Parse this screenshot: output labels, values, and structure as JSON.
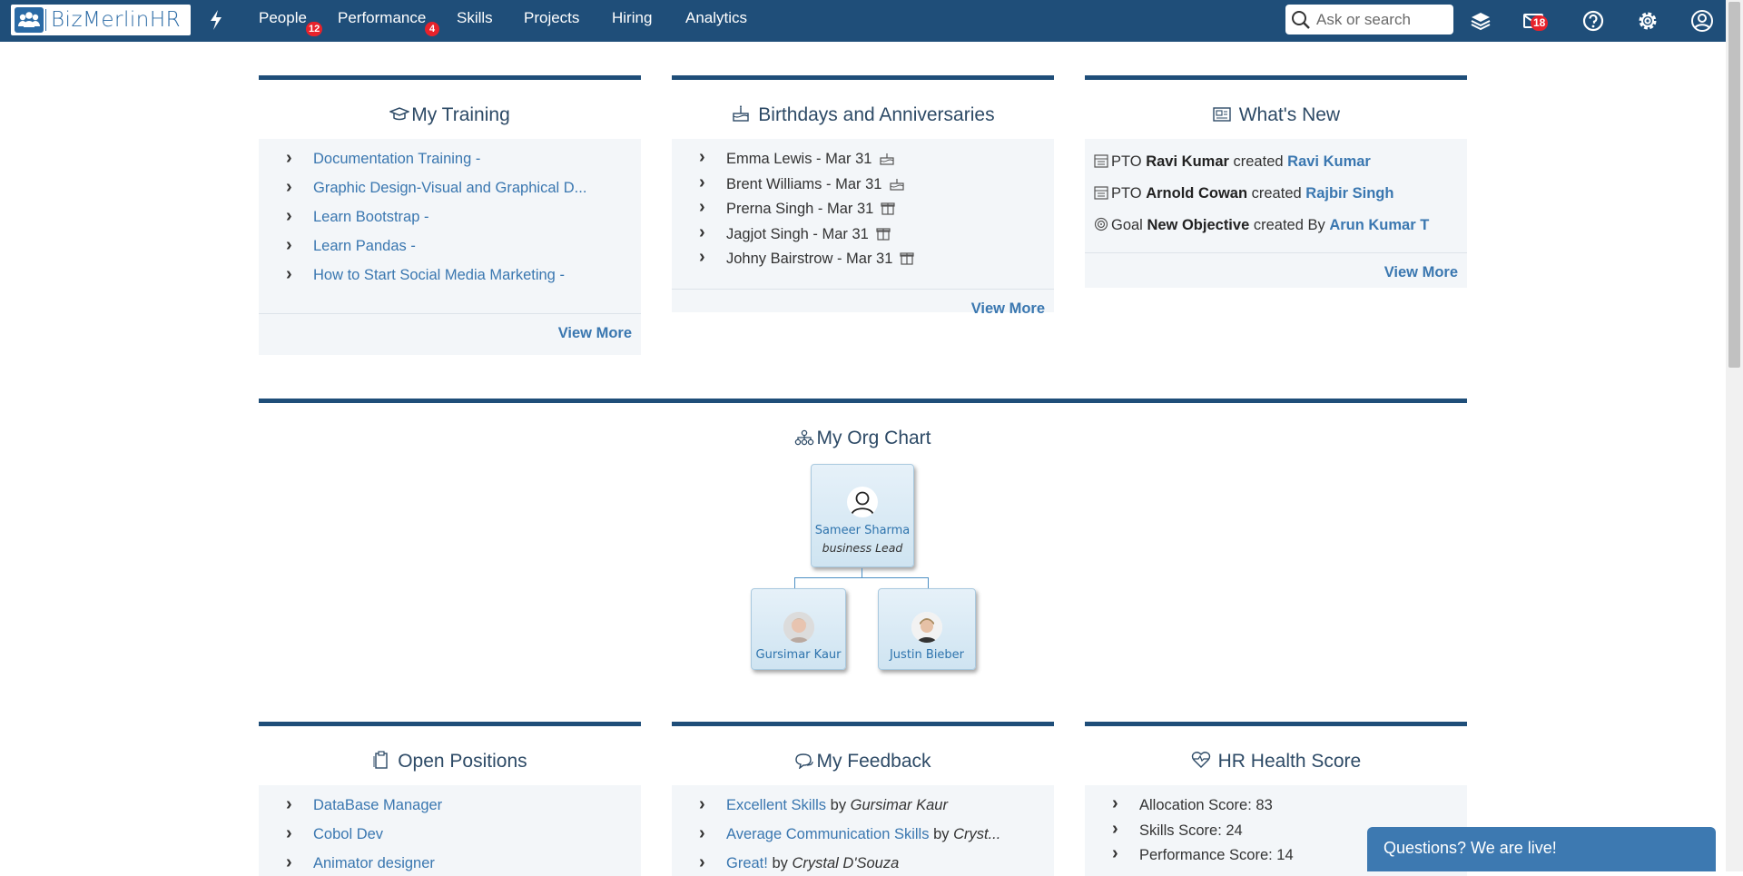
{
  "app": {
    "logo_text": "BizMerlinHR"
  },
  "nav": {
    "items": [
      {
        "label": "People",
        "badge": "12"
      },
      {
        "label": "Performance",
        "badge": "4"
      },
      {
        "label": "Skills"
      },
      {
        "label": "Projects"
      },
      {
        "label": "Hiring"
      },
      {
        "label": "Analytics"
      }
    ],
    "search_placeholder": "Ask or search",
    "inbox_badge": "18"
  },
  "training": {
    "title": "My Training",
    "items": [
      "Documentation Training -",
      "Graphic Design-Visual and Graphical D...",
      "Learn Bootstrap -",
      "Learn Pandas -",
      "How to Start Social Media Marketing -"
    ],
    "view_more": "View More"
  },
  "birthdays": {
    "title": "Birthdays and Anniversaries",
    "items": [
      {
        "text": "Emma Lewis - Mar 31",
        "icon": "cake-icon"
      },
      {
        "text": "Brent Williams - Mar 31",
        "icon": "cake-icon"
      },
      {
        "text": "Prerna Singh - Mar 31",
        "icon": "gift-icon"
      },
      {
        "text": "Jagjot Singh - Mar 31",
        "icon": "gift-icon"
      },
      {
        "text": "Johny Bairstrow - Mar 31",
        "icon": "gift-icon"
      }
    ],
    "view_more": "View More"
  },
  "whats_new": {
    "title": "What's New",
    "items": [
      {
        "icon": "calendar-icon",
        "prefix": "PTO",
        "subject": "Ravi Kumar",
        "verb": "created",
        "link": "Ravi Kumar"
      },
      {
        "icon": "calendar-icon",
        "prefix": "PTO",
        "subject": "Arnold Cowan",
        "verb": "created",
        "link": "Rajbir Singh"
      },
      {
        "icon": "target-icon",
        "prefix": "Goal",
        "subject": "New Objective",
        "verb": "created By",
        "link": "Arun Kumar T"
      }
    ],
    "view_more": "View More"
  },
  "org_chart": {
    "title": "My Org Chart",
    "root": {
      "name": "Sameer Sharma",
      "role": "business Lead"
    },
    "children": [
      {
        "name": "Gursimar Kaur"
      },
      {
        "name": "Justin Bieber"
      }
    ]
  },
  "open_positions": {
    "title": "Open Positions",
    "items": [
      "DataBase Manager",
      "Cobol Dev",
      "Animator designer"
    ]
  },
  "feedback": {
    "title": "My Feedback",
    "items": [
      {
        "link": "Excellent Skills",
        "by": "by",
        "person": "Gursimar Kaur"
      },
      {
        "link": "Average Communication Skills",
        "by": "by",
        "person": "Cryst..."
      },
      {
        "link": "Great!",
        "by": "by",
        "person": "Crystal D'Souza"
      }
    ]
  },
  "hr_health": {
    "title": "HR Health Score",
    "items": [
      "Allocation Score: 83",
      "Skills Score: 24",
      "Performance Score: 14"
    ]
  },
  "chat": {
    "label": "Questions? We are live!"
  },
  "colors": {
    "nav": "#1f4e79",
    "link": "#3a77b0",
    "badge": "#e8222b",
    "panel": "#f3f6f9"
  }
}
